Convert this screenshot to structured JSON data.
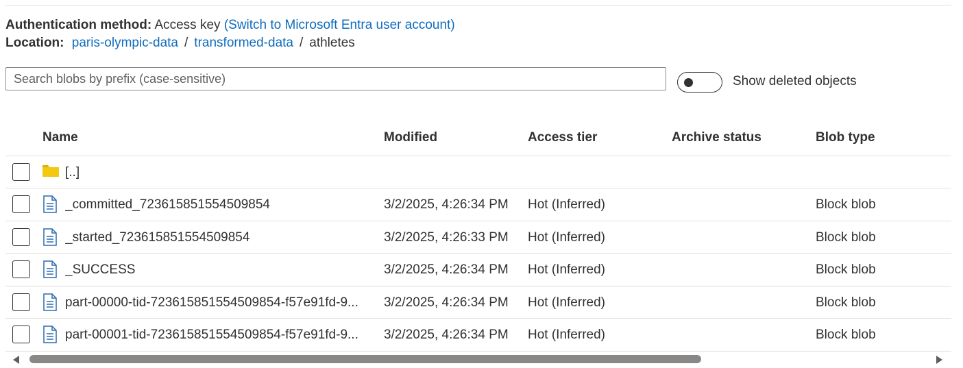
{
  "auth": {
    "label": "Authentication method:",
    "value": "Access key",
    "switch_link": "(Switch to Microsoft Entra user account)"
  },
  "location": {
    "label": "Location:",
    "crumbs": [
      "paris-olympic-data",
      "transformed-data",
      "athletes"
    ],
    "separator": "/"
  },
  "search": {
    "placeholder": "Search blobs by prefix (case-sensitive)",
    "value": ""
  },
  "toggle": {
    "label": "Show deleted objects",
    "on": false
  },
  "table": {
    "columns": [
      "Name",
      "Modified",
      "Access tier",
      "Archive status",
      "Blob type"
    ],
    "rows": [
      {
        "icon": "folder-icon",
        "name": "[..]",
        "modified": "",
        "tier": "",
        "archive": "",
        "type": ""
      },
      {
        "icon": "file-icon",
        "name": "_committed_723615851554509854",
        "modified": "3/2/2025, 4:26:34 PM",
        "tier": "Hot (Inferred)",
        "archive": "",
        "type": "Block blob"
      },
      {
        "icon": "file-icon",
        "name": "_started_723615851554509854",
        "modified": "3/2/2025, 4:26:33 PM",
        "tier": "Hot (Inferred)",
        "archive": "",
        "type": "Block blob"
      },
      {
        "icon": "file-icon",
        "name": "_SUCCESS",
        "modified": "3/2/2025, 4:26:34 PM",
        "tier": "Hot (Inferred)",
        "archive": "",
        "type": "Block blob"
      },
      {
        "icon": "file-icon",
        "name": "part-00000-tid-723615851554509854-f57e91fd-9...",
        "modified": "3/2/2025, 4:26:34 PM",
        "tier": "Hot (Inferred)",
        "archive": "",
        "type": "Block blob"
      },
      {
        "icon": "file-icon",
        "name": "part-00001-tid-723615851554509854-f57e91fd-9...",
        "modified": "3/2/2025, 4:26:34 PM",
        "tier": "Hot (Inferred)",
        "archive": "",
        "type": "Block blob"
      }
    ]
  },
  "colors": {
    "link": "#0f6cbd",
    "folder": "#f2c811",
    "file_icon": "#2b6cb0"
  }
}
